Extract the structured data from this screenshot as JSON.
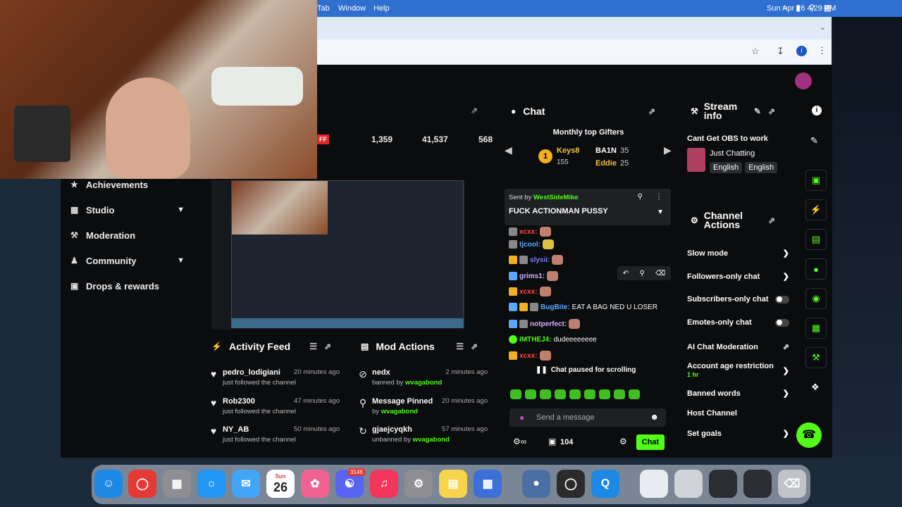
{
  "menubar": {
    "items": [
      "Tab",
      "Window",
      "Help"
    ],
    "datetime": "Sun Apr 26  4:29 PM"
  },
  "sidebar": {
    "items": [
      {
        "label": "Achievements",
        "icon": "trophy-icon",
        "chevron": false
      },
      {
        "label": "Studio",
        "icon": "studio-icon",
        "chevron": true
      },
      {
        "label": "Moderation",
        "icon": "gavel-icon",
        "chevron": false
      },
      {
        "label": "Community",
        "icon": "users-icon",
        "chevron": true
      },
      {
        "label": "Drops & rewards",
        "icon": "gift-icon",
        "chevron": false
      }
    ]
  },
  "stats": {
    "badge": "FF",
    "values": [
      "1,359",
      "41,537",
      "568"
    ]
  },
  "activity_feed": {
    "title": "Activity Feed",
    "rows": [
      {
        "name": "pedro_lodigiani",
        "sub": "just followed the channel",
        "time": "20 minutes ago"
      },
      {
        "name": "Rob2300",
        "sub": "just followed the channel",
        "time": "47 minutes ago"
      },
      {
        "name": "NY_AB",
        "sub": "just followed the channel",
        "time": "50 minutes ago"
      }
    ]
  },
  "mod_actions": {
    "title": "Mod Actions",
    "rows": [
      {
        "name": "nedx",
        "sub_prefix": "banned by",
        "by": "wvagabond",
        "time": "2 minutes ago",
        "icon": "ban-icon"
      },
      {
        "name": "Message Pinned",
        "sub_prefix": "by",
        "by": "wvagabond",
        "time": "20 minutes ago",
        "icon": "pin-icon"
      },
      {
        "name": "gjaejcyqkh",
        "sub_prefix": "unbanned by",
        "by": "wvagabond",
        "time": "57 minutes ago",
        "icon": "unban-icon"
      }
    ]
  },
  "chat": {
    "title": "Chat",
    "gifters_title": "Monthly top Gifters",
    "gifters": [
      {
        "name": "Keys8",
        "count": "155",
        "rank": "1"
      },
      {
        "name": "BA1N",
        "count": "35"
      },
      {
        "name": "Eddie",
        "count": "25"
      }
    ],
    "pinned": {
      "sent_by_label": "Sent by",
      "sender": "WestSideMike",
      "message": "FUCK ACTIONMAN PUSSY"
    },
    "messages": [
      {
        "user": "xcxx:",
        "text": "",
        "color": "#ff4b4b"
      },
      {
        "user": "tjcool:",
        "text": "",
        "color": "#5aa9ff"
      },
      {
        "user": "slysii:",
        "text": "",
        "color": "#7f7fff"
      },
      {
        "user": "grims1:",
        "text": "",
        "color": "#d0b0ff"
      },
      {
        "user": "xcxx:",
        "text": "",
        "color": "#ff4b4b"
      },
      {
        "user": "BugBite:",
        "text": "EAT A BAG NED U LOSER",
        "color": "#5aa9ff"
      },
      {
        "user": "notperfect:",
        "text": "",
        "color": "#d0b0ff"
      },
      {
        "user": "IMTHEJ4:",
        "text": "dudeeeeeeee",
        "color": "#53fc18"
      },
      {
        "user": "xcxx:",
        "text": "",
        "color": "#ff4b4b"
      }
    ],
    "paused": "Chat paused for scrolling",
    "input_placeholder": "Send a message",
    "points": "104",
    "send_label": "Chat"
  },
  "stream_info": {
    "title": "Stream info",
    "stream_title": "Cant Get OBS to work",
    "category": "Just Chatting",
    "tags": [
      "English",
      "English"
    ]
  },
  "channel_actions": {
    "title": "Channel Actions",
    "rows": [
      {
        "label": "Slow mode",
        "control": "arrow"
      },
      {
        "label": "Followers-only chat",
        "control": "arrow"
      },
      {
        "label": "Subscribers-only chat",
        "control": "toggle"
      },
      {
        "label": "Emotes-only chat",
        "control": "toggle"
      },
      {
        "label": "AI Chat Moderation",
        "control": "external"
      },
      {
        "label": "Account age restriction",
        "sub": "1 hr",
        "control": "arrow"
      },
      {
        "label": "Banned words",
        "control": "arrow"
      },
      {
        "label": "Host Channel",
        "control": "none"
      },
      {
        "label": "Set goals",
        "control": "arrow"
      }
    ]
  },
  "dock": {
    "calendar_day": "26",
    "calendar_month": "Sun",
    "discord_badge": "3146"
  },
  "colors": {
    "accent": "#53fc18",
    "menubar": "#2f6fd0",
    "panel": "#0b0c0e"
  }
}
